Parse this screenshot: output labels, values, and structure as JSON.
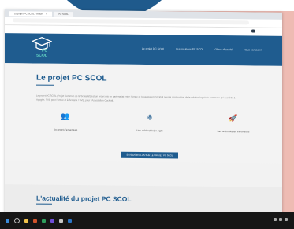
{
  "browser": {
    "tabs": [
      {
        "label": "Le projet PC SCOL - Amue",
        "active": true
      },
      {
        "label": "PC SCOL",
        "active": false
      }
    ]
  },
  "header": {
    "logo_line1": "PC",
    "logo_line2": "SCOL",
    "nav": [
      {
        "label": "Le projet PC SCOL"
      },
      {
        "label": "Les solutions PC SCOL"
      },
      {
        "label": "Offres d'emploi"
      },
      {
        "label": "Nous contacter"
      }
    ]
  },
  "hero": {
    "title": "Le projet PC SCOL",
    "intro": "Le projet PC SCOL (Projet Commun de la Scolarité) est un projet mis en partenariat entre l'Amue et l'Association Cocktail pour la construction de la solution logicielle commune qui succède à Apogée, SVE pour l'Amue et à Scolarix / SVE, pour l'Association Cocktail.",
    "features": [
      {
        "icon": "people-icon",
        "glyph": "👥",
        "caption": "Un projet d'envergure"
      },
      {
        "icon": "gear-icon",
        "glyph": "❄",
        "caption": "Une méthodologie Agile"
      },
      {
        "icon": "rocket-icon",
        "glyph": "🚀",
        "caption": "Des technologies innovantes"
      }
    ],
    "cta": "EN SAVOIR PLUS SUR LE PROJET PC SCOL"
  },
  "news": {
    "title": "L'actualité du projet PC SCOL"
  },
  "colors": {
    "primary": "#1f5c8f",
    "accent": "#64d6c4",
    "frame": "#eebbb3"
  }
}
